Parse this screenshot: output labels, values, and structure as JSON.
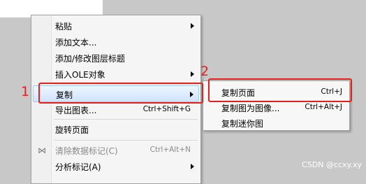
{
  "context_menu": {
    "items": [
      {
        "label": "粘贴",
        "has_submenu": true
      },
      {
        "label": "添加文本..."
      },
      {
        "label": "添加/修改图层标题"
      },
      {
        "label": "插入OLE对象",
        "has_submenu": true
      },
      {
        "label": "复制",
        "has_submenu": true,
        "highlighted": true
      },
      {
        "label": "导出图表...",
        "shortcut": "Ctrl+Shift+G"
      },
      {
        "label": "旋转页面"
      },
      {
        "label": "清除数据标记(C)",
        "shortcut": "Ctrl+Alt+N",
        "disabled": true
      },
      {
        "label": "分析标记(A)",
        "has_submenu": true
      }
    ]
  },
  "copy_submenu": {
    "items": [
      {
        "label": "复制页面",
        "shortcut": "Ctrl+J"
      },
      {
        "label": "复制图为图像...",
        "shortcut": "Ctrl+Alt+J"
      },
      {
        "label": "复制迷你图"
      }
    ]
  },
  "annotations": {
    "step1": "1",
    "step2": "2",
    "highlight_color": "#e3201b"
  },
  "watermark": "CSDN @ccxy.xy"
}
